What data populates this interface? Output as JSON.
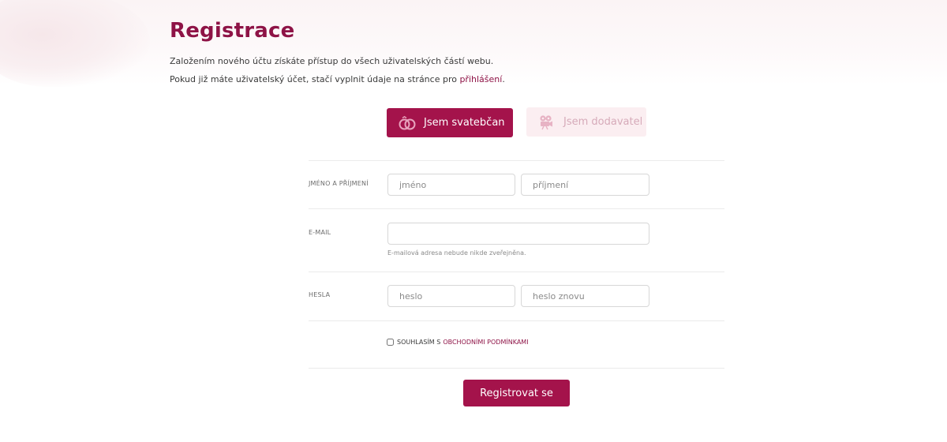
{
  "page": {
    "title": "Registrace",
    "intro_line1": "Založením nového účtu získáte přístup do všech uživatelských částí webu.",
    "intro_line2_prefix": "Pokud již máte uživatelský účet, stačí vyplnit údaje na stránce pro ",
    "login_link": "přihlášení",
    "intro_line2_suffix": "."
  },
  "roles": {
    "couple_label": "Jsem svatebčan",
    "couple_icon": "wedding-rings-icon",
    "vendor_label": "Jsem dodavatel",
    "vendor_icon": "video-camera-icon"
  },
  "form": {
    "name_label": "JMÉNO A PŘÍJMENÍ",
    "first_name_placeholder": "jméno",
    "last_name_placeholder": "příjmení",
    "email_label": "E-MAIL",
    "email_value": "",
    "email_hint": "E-mailová adresa nebude nikde zveřejněna.",
    "password_label": "HESLA",
    "password_placeholder": "heslo",
    "password_repeat_placeholder": "heslo znovu",
    "terms_prefix": "SOUHLASÍM S",
    "terms_link": "OBCHODNÍMI PODMÍNKAMI",
    "submit_label": "Registrovat se"
  },
  "colors": {
    "brand": "#a4134b",
    "title": "#8e1346",
    "inactive_bg": "#fbeef1",
    "inactive_text": "#d6aab9"
  }
}
